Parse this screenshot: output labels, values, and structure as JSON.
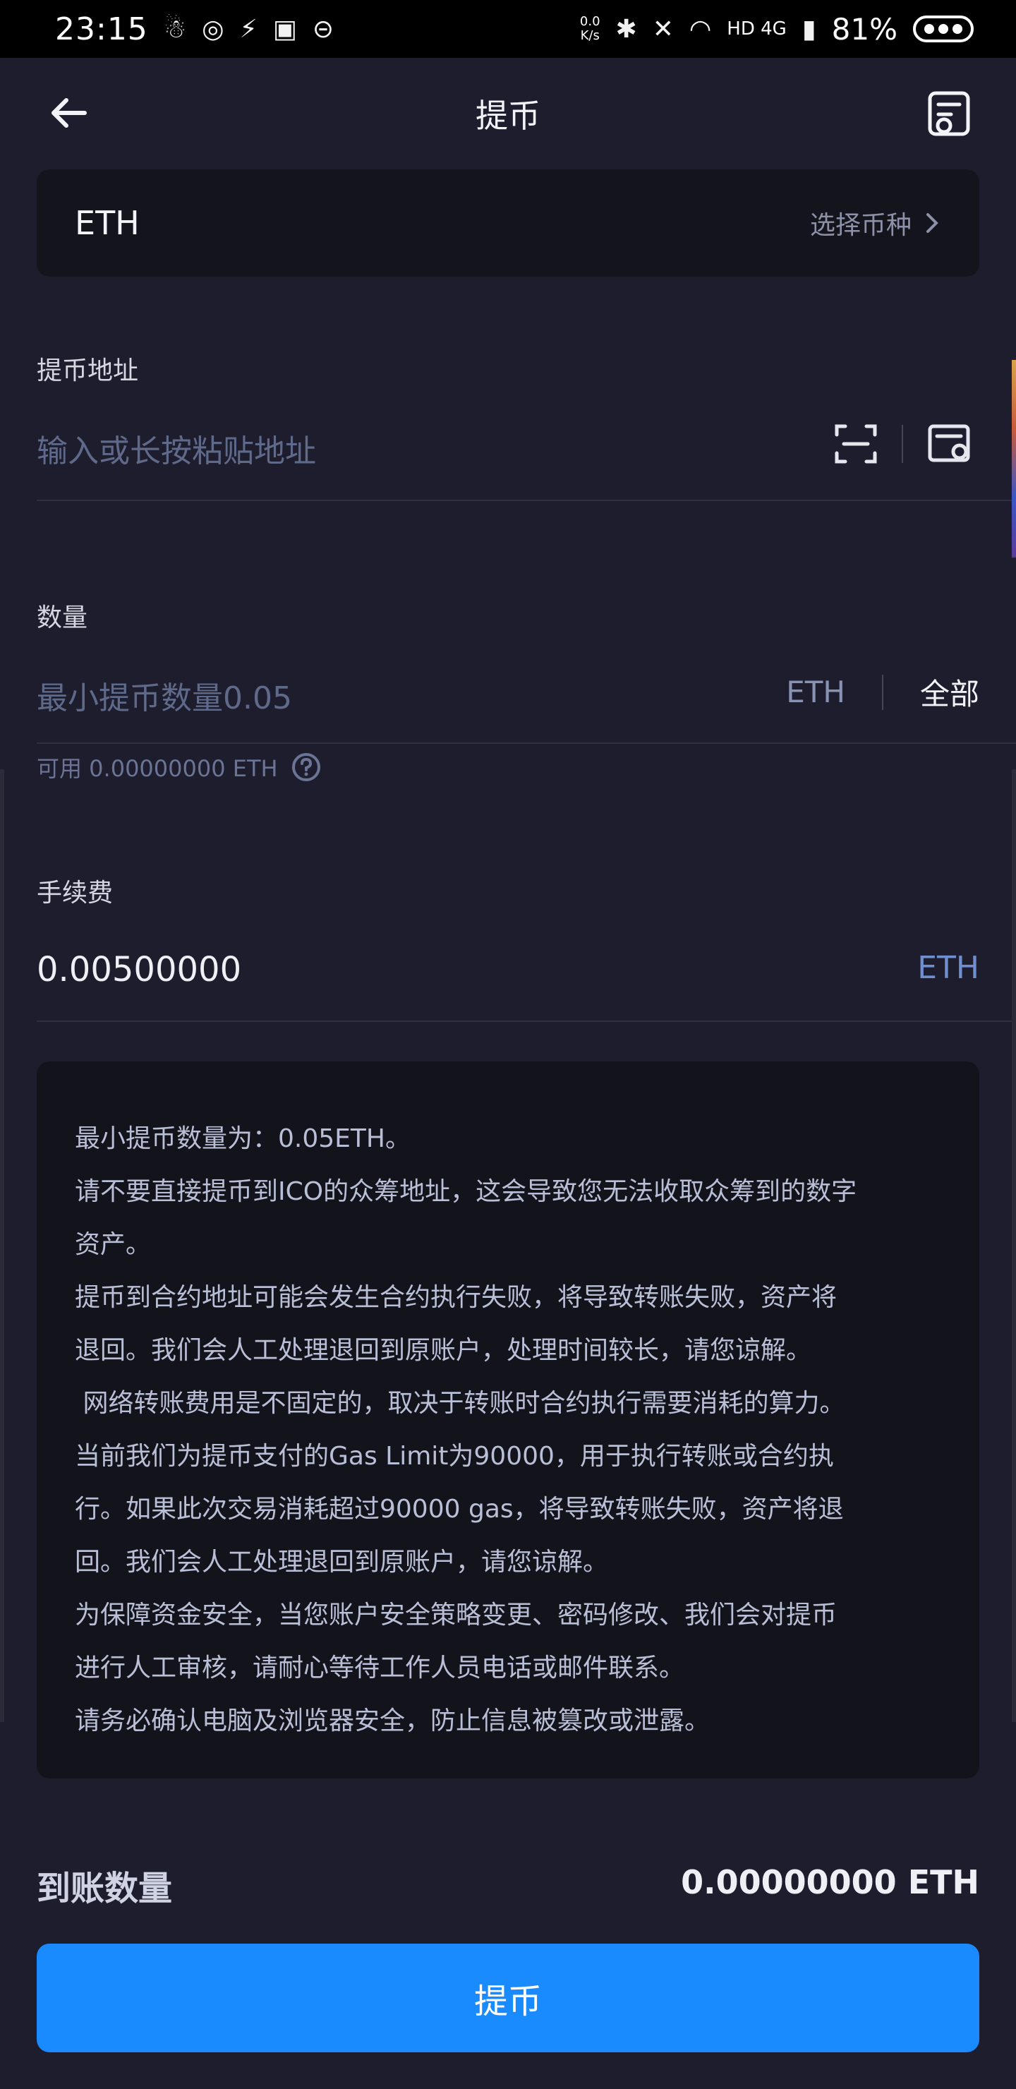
{
  "status_bar": {
    "time": "23:15",
    "net_speed_top": "0.0",
    "net_speed_bottom": "K/s",
    "network": "HD 4G",
    "battery": "81%"
  },
  "header": {
    "title": "提币"
  },
  "coin": {
    "name": "ETH",
    "select_label": "选择币种"
  },
  "address": {
    "label": "提币地址",
    "placeholder": "输入或长按粘贴地址"
  },
  "amount": {
    "label": "数量",
    "placeholder": "最小提币数量0.05",
    "unit": "ETH",
    "all_label": "全部",
    "available": "可用 0.00000000 ETH"
  },
  "fee": {
    "label": "手续费",
    "value": "0.00500000",
    "unit": "ETH"
  },
  "notice": {
    "lines": [
      "最小提币数量为：0.05ETH。",
      "请不要直接提币到ICO的众筹地址，这会导致您无法收取众筹到的数字",
      "资产。",
      "提币到合约地址可能会发生合约执行失败，将导致转账失败，资产将",
      "退回。我们会人工处理退回到原账户，处理时间较长，请您谅解。",
      " 网络转账费用是不固定的，取决于转账时合约执行需要消耗的算力。",
      "当前我们为提币支付的Gas Limit为90000，用于执行转账或合约执",
      "行。如果此次交易消耗超过90000 gas，将导致转账失败，资产将退",
      "回。我们会人工处理退回到原账户，请您谅解。",
      "为保障资金安全，当您账户安全策略变更、密码修改、我们会对提币",
      "进行人工审核，请耐心等待工作人员电话或邮件联系。",
      "请务必确认电脑及浏览器安全，防止信息被篡改或泄露。"
    ]
  },
  "arrival": {
    "label": "到账数量",
    "value": "0.00000000 ETH"
  },
  "submit_label": "提币",
  "colors": {
    "background": "#1e1d2e",
    "card": "#14141d",
    "accent": "#1a8bff",
    "placeholder": "#5f6a8a"
  },
  "icons": {
    "back": "arrow-left-icon",
    "record": "withdraw-record-icon",
    "scan": "scan-icon",
    "address_book": "address-book-icon",
    "help": "question-circle-icon",
    "chevron": "chevron-right-icon"
  }
}
